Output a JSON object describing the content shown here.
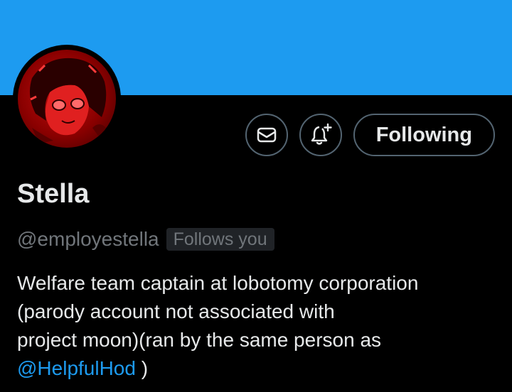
{
  "profile": {
    "display_name": "Stella",
    "handle": "@employestella",
    "follows_you_badge": "Follows you",
    "bio": {
      "line1": "Welfare team captain at lobotomy corporation",
      "line2": "(parody account not associated with",
      "line3": "project moon)(ran by the same person as",
      "mention": "@HelpfulHod",
      "line4_suffix": " )"
    }
  },
  "actions": {
    "message_icon": "envelope-icon",
    "notify_icon": "bell-plus-icon",
    "following_label": "Following"
  },
  "colors": {
    "banner": "#1d9bf0",
    "background": "#000000",
    "text_primary": "#e7e9ea",
    "text_secondary": "#71767b",
    "link": "#1d9bf0",
    "button_border": "#536471",
    "badge_bg": "#202327"
  }
}
